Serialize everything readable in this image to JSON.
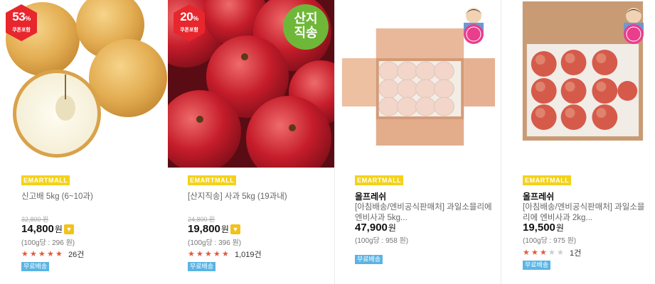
{
  "products": [
    {
      "discount": "53",
      "discount_unit": "%",
      "discount_sub": "쿠폰포함",
      "seller": "EMARTMALL",
      "brand": "",
      "title": "신고배 5kg (6~10과)",
      "original_price": "32,800 원",
      "price": "14,800",
      "price_unit": "원",
      "unit_price": "(100g당 : 296 원)",
      "rating": 5,
      "review_count": "26건",
      "shipping": "무료배송",
      "image_icon": "pear-image"
    },
    {
      "discount": "20",
      "discount_unit": "%",
      "discount_sub": "쿠폰포함",
      "image_label_1": "산지",
      "image_label_2": "직송",
      "seller": "EMARTMALL",
      "brand": "",
      "title": "[산지직송] 사과 5kg (19과내)",
      "original_price": "24,800 원",
      "price": "19,800",
      "price_unit": "원",
      "unit_price": "(100g당 : 396 원)",
      "rating": 5,
      "review_count": "1,019건",
      "shipping": "무료배송",
      "image_icon": "apple-image"
    },
    {
      "seller": "EMARTMALL",
      "brand": "올프레쉬",
      "title": "[아침배송/엔비공식판매처] 과일소믈리에 엔비사과 5kg...",
      "price": "47,900",
      "price_unit": "원",
      "unit_price": "(100g당 : 958 원)",
      "shipping": "무료배송",
      "image_icon": "apple-box-image"
    },
    {
      "seller": "EMARTMALL",
      "brand": "올프레쉬",
      "title": "[아침배송/엔비공식판매처] 과일소믈리에 엔비사과 2kg...",
      "price": "19,500",
      "price_unit": "원",
      "unit_price": "(100g당 : 975 원)",
      "rating": 3,
      "review_count": "1건",
      "shipping": "무료배송",
      "image_icon": "apple-box-image"
    }
  ],
  "colors": {
    "badge_red": "#e8262d",
    "seller_yellow": "#f4d21a",
    "star_red": "#e25a3b",
    "shipping_blue": "#5ab4e4"
  }
}
